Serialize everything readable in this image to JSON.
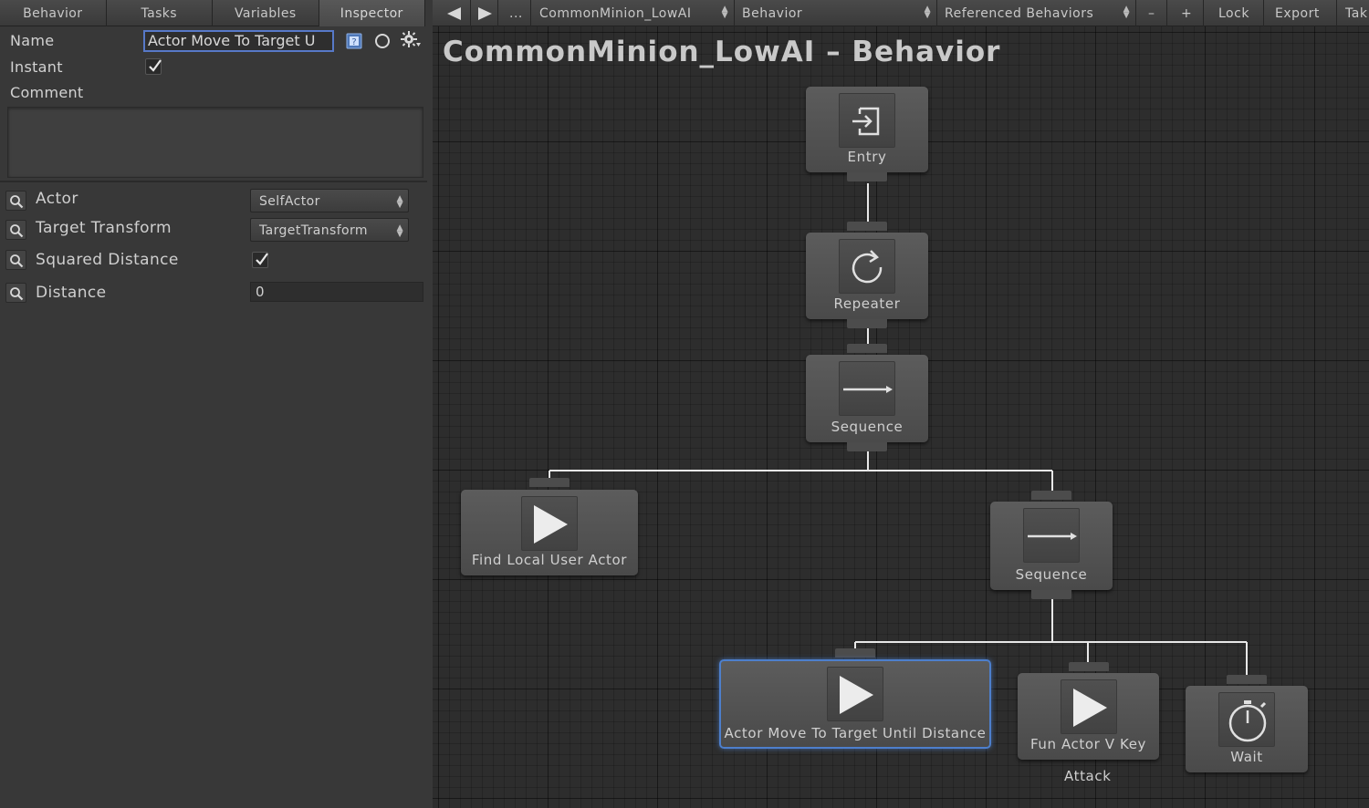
{
  "left_tabs": [
    "Behavior",
    "Tasks",
    "Variables",
    "Inspector"
  ],
  "inspector": {
    "name_label": "Name",
    "name_value": "Actor Move To Target U",
    "instant_label": "Instant",
    "instant_checked": true,
    "comment_label": "Comment",
    "fields": {
      "actor_label": "Actor",
      "actor_value": "SelfActor",
      "target_label": "Target Transform",
      "target_value": "TargetTransform",
      "squared_label": "Squared Distance",
      "squared_checked": true,
      "distance_label": "Distance",
      "distance_value": "0"
    }
  },
  "toolbar": {
    "ellipsis": "...",
    "behavior_source": "CommonMinion_LowAI",
    "behavior_type": "Behavior",
    "referenced": "Referenced Behaviors",
    "minus": "–",
    "plus": "+",
    "lock": "Lock",
    "export": "Export",
    "take": "Tak"
  },
  "graph": {
    "title": "CommonMinion_LowAI – Behavior",
    "nodes": {
      "entry": "Entry",
      "repeater": "Repeater",
      "sequence1": "Sequence",
      "find_local": "Find Local User Actor",
      "sequence2": "Sequence",
      "move_to": "Actor Move To Target Until Distance",
      "fun_actor": "Fun Actor V Key",
      "fun_actor_comment": "Attack",
      "wait": "Wait"
    }
  },
  "colors": {
    "selection": "#4d7fcc",
    "name_input_border": "#5779c8"
  }
}
